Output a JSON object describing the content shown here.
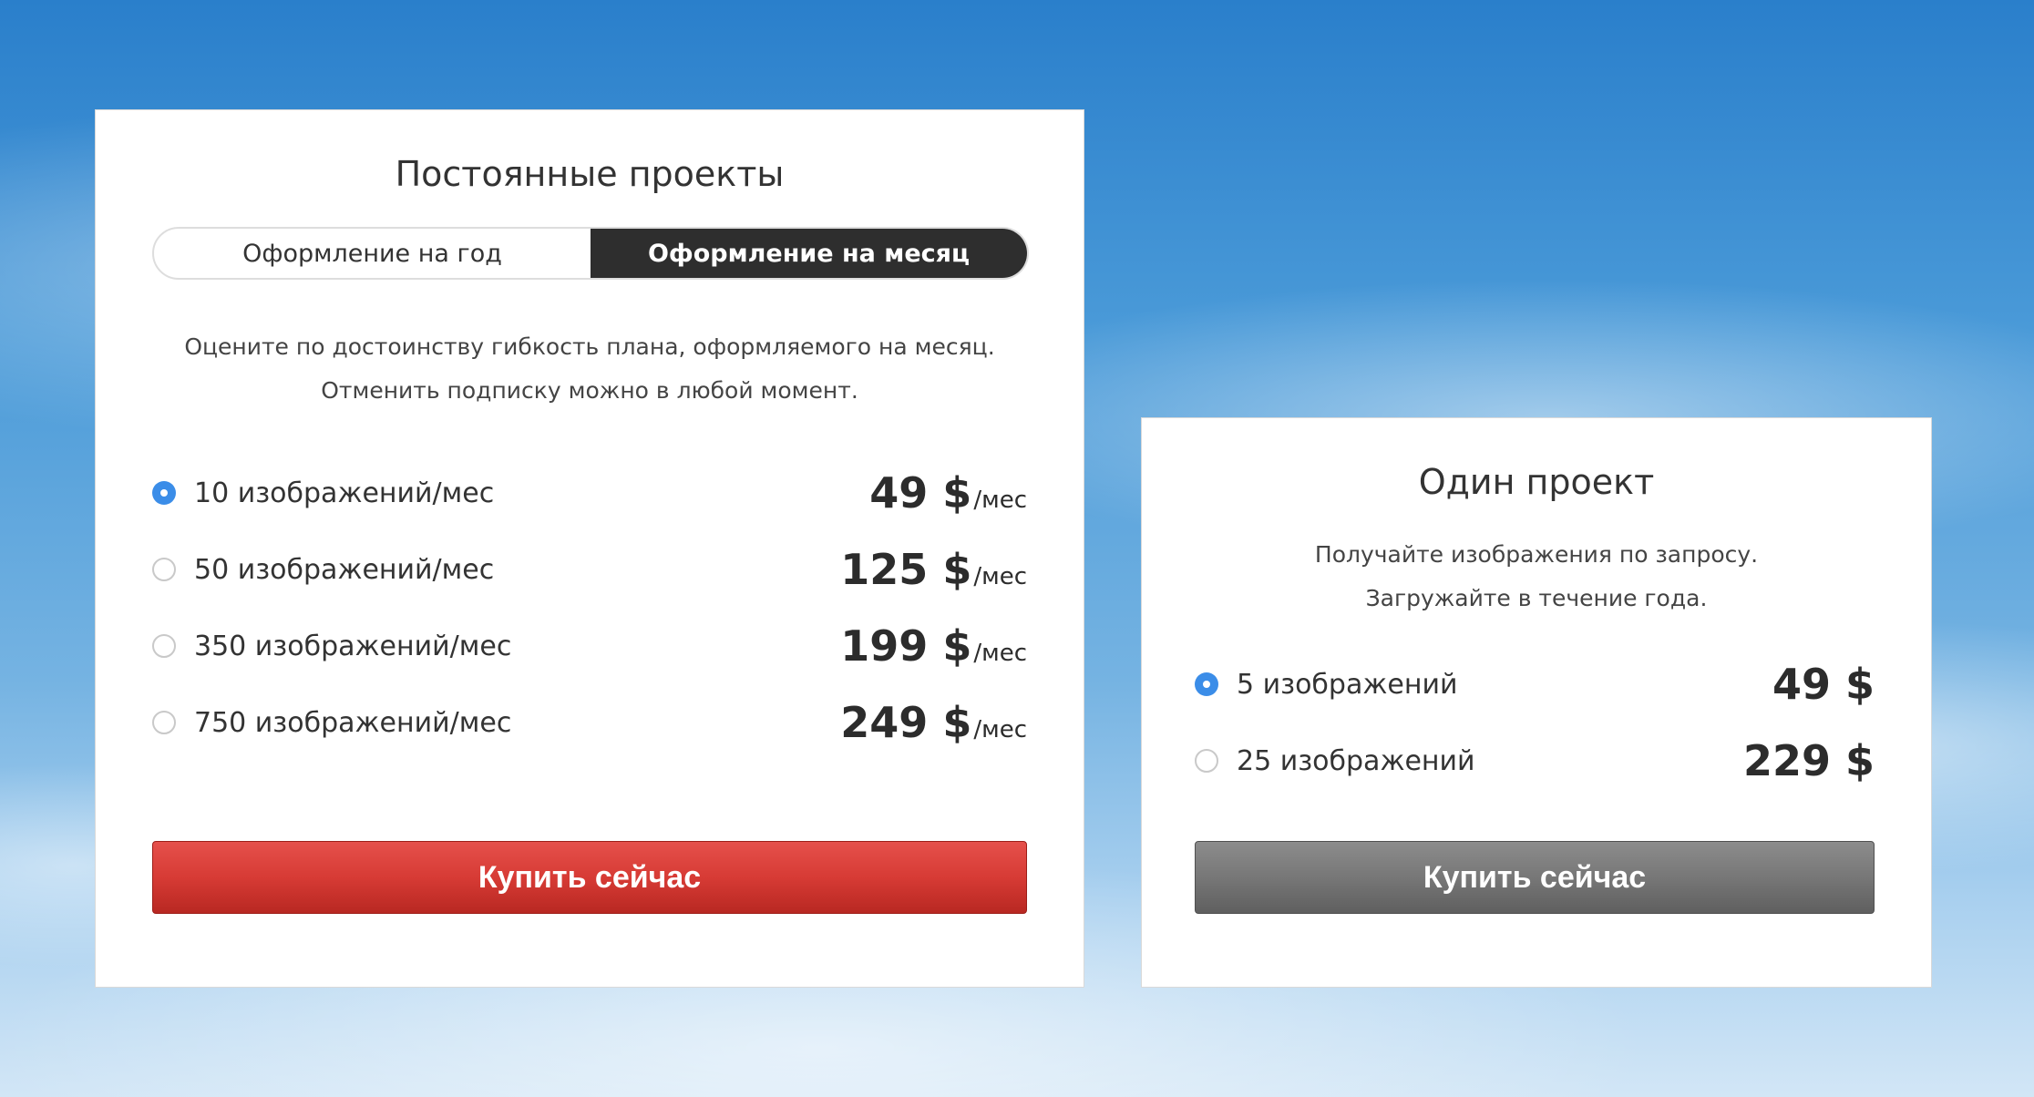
{
  "subscription_card": {
    "title": "Постоянные проекты",
    "toggle": {
      "yearly_label": "Оформление на год",
      "monthly_label": "Оформление на месяц",
      "selected": "monthly"
    },
    "description": {
      "line1": "Оцените по достоинству гибкость плана, оформляемого на месяц.",
      "line2": "Отменить подписку можно в любой момент."
    },
    "plans": [
      {
        "label": "10 изображений/мес",
        "price": "49 $",
        "unit": "/мес",
        "selected": true
      },
      {
        "label": "50 изображений/мес",
        "price": "125 $",
        "unit": "/мес",
        "selected": false
      },
      {
        "label": "350 изображений/мес",
        "price": "199 $",
        "unit": "/мес",
        "selected": false
      },
      {
        "label": "750 изображений/мес",
        "price": "249 $",
        "unit": "/мес",
        "selected": false
      }
    ],
    "buy_label": "Купить сейчас"
  },
  "single_card": {
    "title": "Один проект",
    "description": {
      "line1": "Получайте изображения по запросу.",
      "line2": "Загружайте в течение года."
    },
    "plans": [
      {
        "label": "5 изображений",
        "price": "49 $",
        "selected": true
      },
      {
        "label": "25 изображений",
        "price": "229 $",
        "selected": false
      }
    ],
    "buy_label": "Купить сейчас"
  },
  "colors": {
    "accent_red": "#d73b35",
    "radio_blue": "#3b8de8",
    "toggle_active": "#2e2e2e",
    "button_gray": "#777777"
  }
}
